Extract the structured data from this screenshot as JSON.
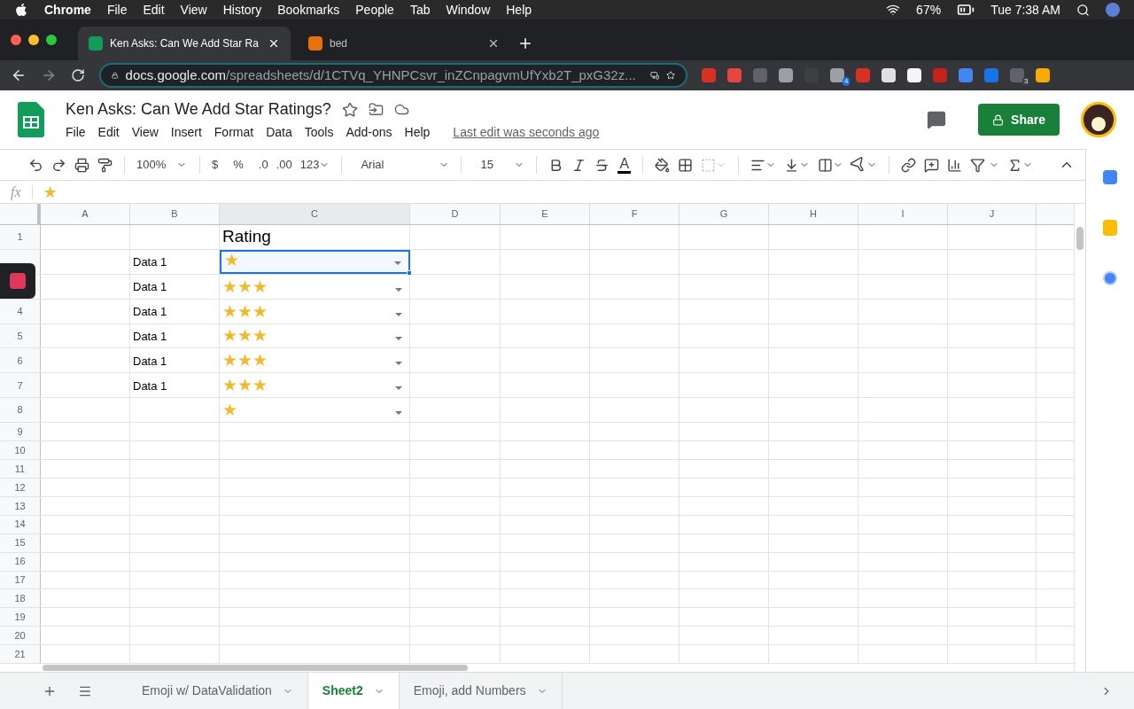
{
  "menubar": {
    "app": "Chrome",
    "menus": [
      "File",
      "Edit",
      "View",
      "History",
      "Bookmarks",
      "People",
      "Tab",
      "Window",
      "Help"
    ],
    "battery": "67%",
    "clock": "Tue 7:38 AM"
  },
  "browser_tabs": [
    {
      "title": "Ken Asks: Can We Add Star Ra",
      "selected": true
    },
    {
      "title": "bed",
      "selected": false
    }
  ],
  "address": {
    "host": "docs.google.com",
    "path": "/spreadsheets/d/1CTVq_YHNPCsvr_inZCnpagvmUfYxb2T_pxG32z..."
  },
  "extension_badges": [
    "4",
    "3"
  ],
  "doc": {
    "title": "Ken Asks: Can We Add Star Ratings?",
    "menus": [
      "File",
      "Edit",
      "View",
      "Insert",
      "Format",
      "Data",
      "Tools",
      "Add-ons",
      "Help"
    ],
    "last_edit": "Last edit was seconds ago",
    "share": "Share"
  },
  "toolbar": {
    "zoom": "100%",
    "currency": "$",
    "percent": "%",
    "dec_less": ".0",
    "dec_more": ".00",
    "number_format": "123",
    "font": "Arial",
    "font_size": "15",
    "text_color": "A"
  },
  "formula_bar": {
    "label": "fx",
    "content": "★"
  },
  "columns": [
    "A",
    "B",
    "C",
    "D",
    "E",
    "F",
    "G",
    "H",
    "I",
    "J"
  ],
  "rows": [
    {
      "number": "1",
      "c": "Rating"
    },
    {
      "b": "Data 1",
      "rating": "★",
      "dropdown": true,
      "selected": true
    },
    {
      "b": "Data 1",
      "rating": "★★★",
      "dropdown": true,
      "selected": false
    },
    {
      "number": "4",
      "b": "Data 1",
      "rating": "★★★",
      "dropdown": true,
      "selected": false
    },
    {
      "number": "5",
      "b": "Data 1",
      "rating": "★★★",
      "dropdown": true,
      "selected": false
    },
    {
      "number": "6",
      "b": "Data 1",
      "rating": "★★★",
      "dropdown": true,
      "selected": false
    },
    {
      "number": "7",
      "b": "Data 1",
      "rating": "★★★",
      "dropdown": true,
      "selected": false
    },
    {
      "number": "8",
      "rating": "★",
      "dropdown": true,
      "selected": false
    },
    {
      "number": "9"
    },
    {
      "number": "10"
    },
    {
      "number": "11"
    },
    {
      "number": "12"
    },
    {
      "number": "13"
    },
    {
      "number": "14"
    },
    {
      "number": "15"
    },
    {
      "number": "16"
    },
    {
      "number": "17"
    },
    {
      "number": "18"
    },
    {
      "number": "19"
    },
    {
      "number": "20"
    },
    {
      "number": "21"
    }
  ],
  "sheets": [
    {
      "name": "Emoji w/ DataValidation",
      "selected": false
    },
    {
      "name": "Sheet2",
      "selected": true
    },
    {
      "name": "Emoji, add Numbers",
      "selected": false
    }
  ]
}
